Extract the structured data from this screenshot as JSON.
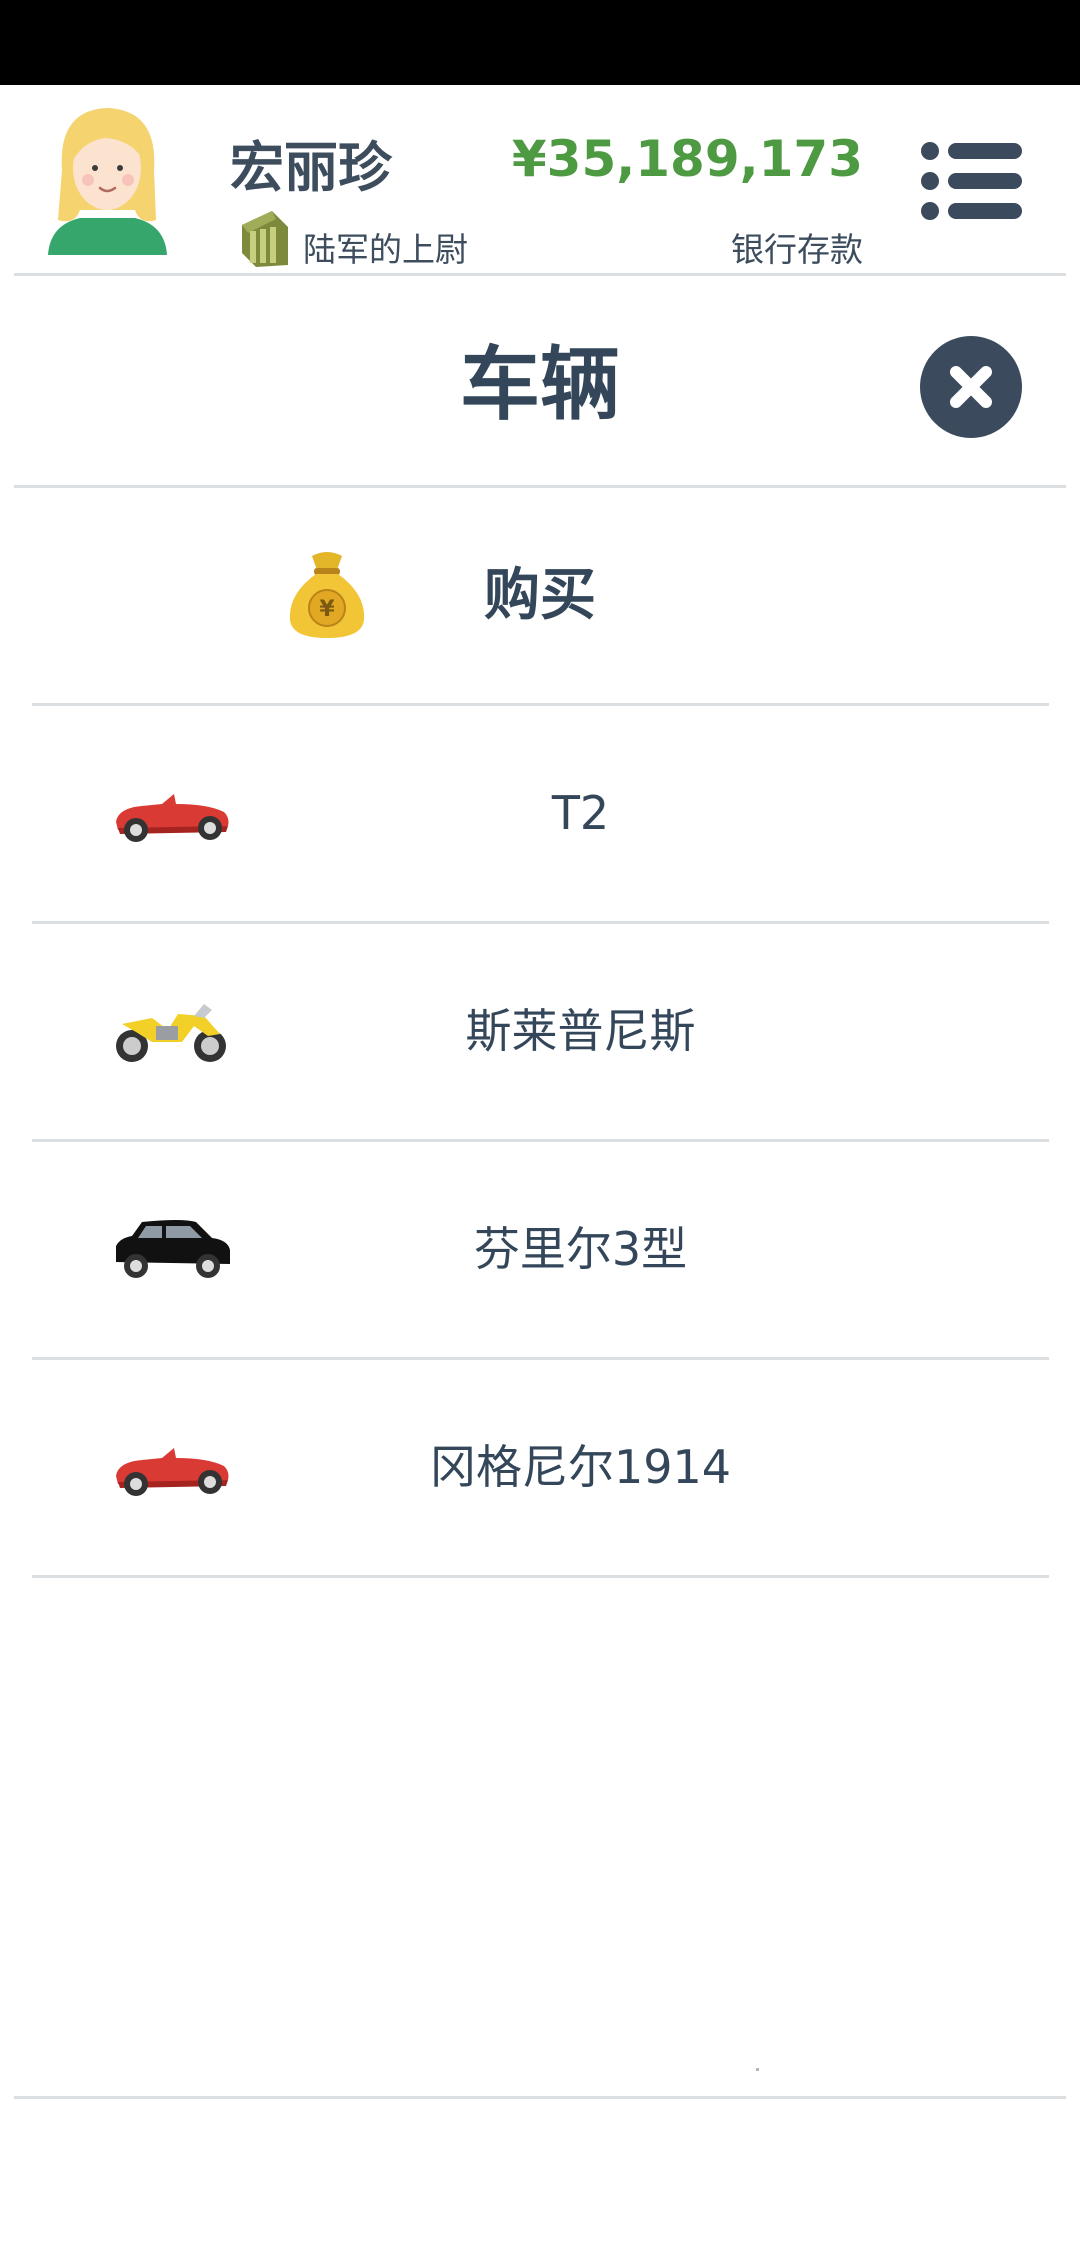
{
  "player": {
    "name": "宏丽珍",
    "rank": "陆军的上尉",
    "balance": "¥35,189,173",
    "balance_label": "银行存款"
  },
  "page": {
    "title": "车辆"
  },
  "buy": {
    "label": "购买",
    "icon": "money-bag-icon"
  },
  "vehicles": [
    {
      "name": "T2",
      "icon": "red-convertible-icon"
    },
    {
      "name": "斯莱普尼斯",
      "icon": "yellow-motorcycle-icon"
    },
    {
      "name": "芬里尔3型",
      "icon": "black-suv-icon"
    },
    {
      "name": "冈格尼尔1914",
      "icon": "red-convertible-icon"
    }
  ],
  "colors": {
    "accent_green": "#4e9a43",
    "dark_slate": "#34475a",
    "divider": "#dcdfe2"
  }
}
